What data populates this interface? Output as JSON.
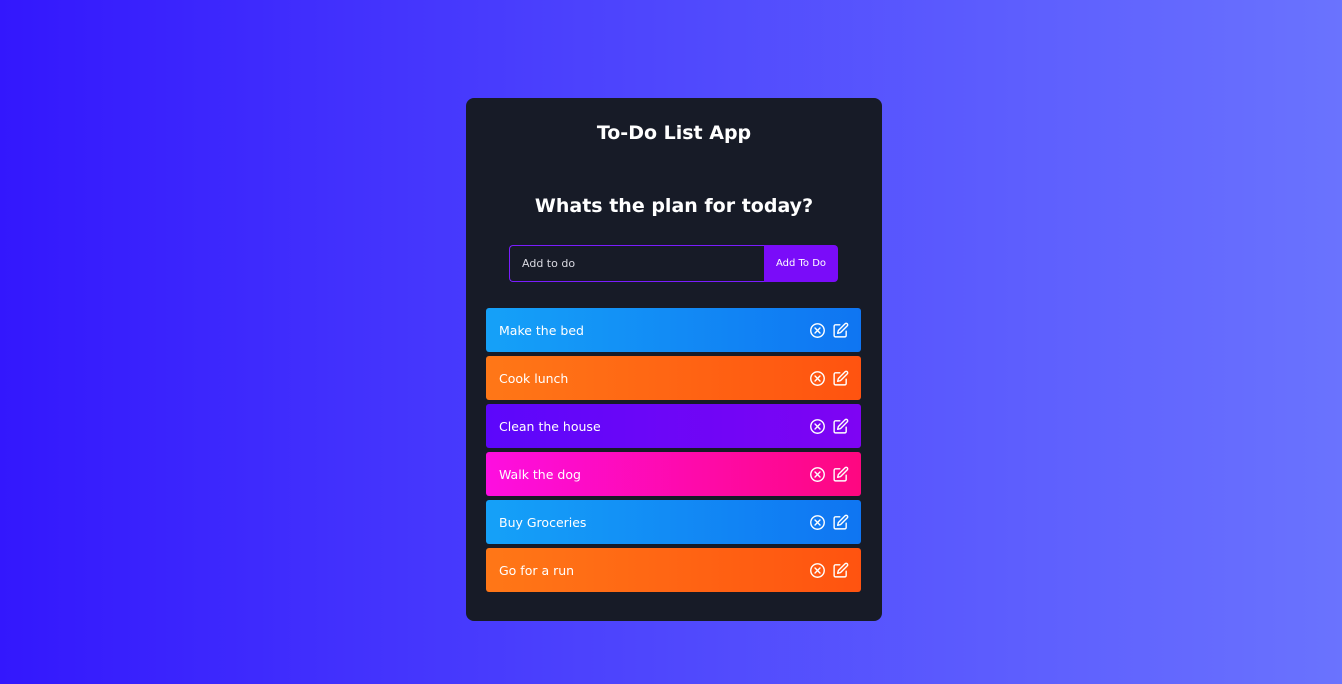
{
  "app": {
    "title": "To-Do List App",
    "heading": "Whats the plan for today?"
  },
  "form": {
    "placeholder": "Add to do",
    "value": "",
    "button_label": "Add To Do"
  },
  "todos": [
    {
      "text": "Make the bed",
      "gradient": [
        "#15a1f8",
        "#0f75f2"
      ],
      "delete_icon": "close-circle-icon",
      "edit_icon": "edit-icon"
    },
    {
      "text": "Cook lunch",
      "gradient": [
        "#ff7717",
        "#ff5310"
      ],
      "delete_icon": "close-circle-icon",
      "edit_icon": "edit-icon"
    },
    {
      "text": "Clean the house",
      "gradient": [
        "#5c07fb",
        "#7e04f3"
      ],
      "delete_icon": "close-circle-icon",
      "edit_icon": "edit-icon"
    },
    {
      "text": "Walk the dog",
      "gradient": [
        "#fd0ee0",
        "#fe0780"
      ],
      "delete_icon": "close-circle-icon",
      "edit_icon": "edit-icon"
    },
    {
      "text": "Buy Groceries",
      "gradient": [
        "#15a1f8",
        "#0f75f2"
      ],
      "delete_icon": "close-circle-icon",
      "edit_icon": "edit-icon"
    },
    {
      "text": "Go for a run",
      "gradient": [
        "#ff7717",
        "#ff5310"
      ],
      "delete_icon": "close-circle-icon",
      "edit_icon": "edit-icon"
    }
  ],
  "colors": {
    "background_start": "#3317fd",
    "background_end": "#6a73fe",
    "card": "#171b27",
    "accent": "#7a0cf9"
  }
}
